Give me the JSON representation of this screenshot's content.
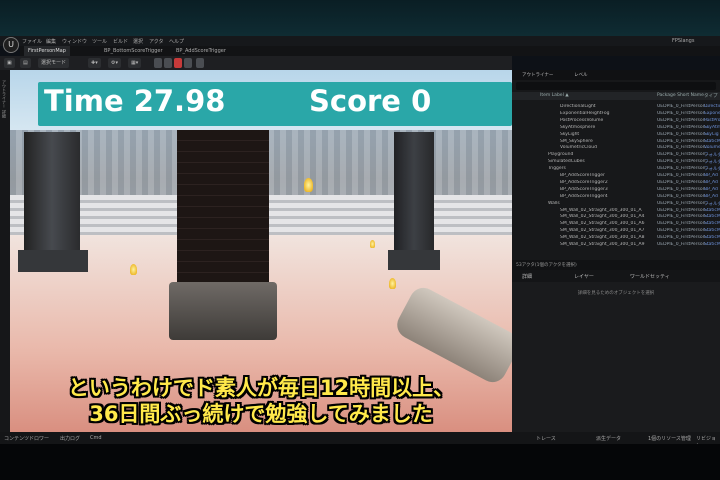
{
  "menu": [
    "ファイル",
    "編集",
    "ウィンドウ",
    "ツール",
    "ビルド",
    "選択",
    "アクタ",
    "ヘルプ"
  ],
  "menu_right": "FPSlangs",
  "tabs": [
    "FirstPersonMap",
    "BP_BottomScoreTrigger",
    "BP_AddScoreTrigger"
  ],
  "toolbar": {
    "mode_label": "選択モード"
  },
  "hud": {
    "time": "Time 27.98",
    "score": "Score 0"
  },
  "subtitle": {
    "line1": "というわけでド素人が毎日12時間以上、",
    "line2": "36日間ぶっ続けで勉強してみました"
  },
  "left_strip": [
    "アウトライナー",
    "詳細"
  ],
  "outliner": {
    "tabs": [
      "アウトライナー",
      "レベル"
    ],
    "columns": [
      "Item Label ▲",
      "Package Short Name",
      "タイプ"
    ],
    "rows": [
      {
        "name": "DirectionalLight",
        "pkg": "UEDPIE_0_FirstPerson...",
        "type": "Directio"
      },
      {
        "name": "ExponentialHeightFog",
        "pkg": "UEDPIE_0_FirstPerson...",
        "type": "Expone"
      },
      {
        "name": "PostProcessVolume",
        "pkg": "UEDPIE_0_FirstPerson...",
        "type": "PostPro"
      },
      {
        "name": "SkyAtmosphere",
        "pkg": "UEDPIE_0_FirstPerson...",
        "type": "SkyAtm"
      },
      {
        "name": "SkyLight",
        "pkg": "UEDPIE_0_FirstPerson...",
        "type": "SkyLig"
      },
      {
        "name": "SM_SkySphere",
        "pkg": "UEDPIE_0_FirstPerson...",
        "type": "StaticM"
      },
      {
        "name": "VolumetricCloud",
        "pkg": "UEDPIE_0_FirstPerson...",
        "type": "Volume"
      },
      {
        "name": "Playground",
        "pkg": "UEDPIE_0_FirstPerson...",
        "type": "フォルダ"
      },
      {
        "name": "SimulatedCubes",
        "pkg": "UEDPIE_0_FirstPerson...",
        "type": "フォルダ"
      },
      {
        "name": "Triggers",
        "pkg": "UEDPIE_0_FirstPerson...",
        "type": "フォルダ"
      },
      {
        "name": "BP_AddScoreTrigger",
        "pkg": "UEDPIE_0_FirstPerson...",
        "type": "BP_Ad"
      },
      {
        "name": "BP_AddScoreTrigger2",
        "pkg": "UEDPIE_0_FirstPerson...",
        "type": "BP_Ad"
      },
      {
        "name": "BP_AddScoreTrigger3",
        "pkg": "UEDPIE_0_FirstPerson...",
        "type": "BP_Ad"
      },
      {
        "name": "BP_AddScoreTrigger4",
        "pkg": "UEDPIE_0_FirstPerson...",
        "type": "BP_Ad"
      },
      {
        "name": "Walls",
        "pkg": "UEDPIE_0_FirstPerson...",
        "type": "フォルダ"
      },
      {
        "name": "SM_Wall_02_Straight_300_300_01_A",
        "pkg": "UEDPIE_0_FirstPerson...",
        "type": "StaticM"
      },
      {
        "name": "SM_Wall_02_Straight_300_300_01_A4",
        "pkg": "UEDPIE_0_FirstPerson...",
        "type": "StaticM"
      },
      {
        "name": "SM_Wall_02_Straight_300_300_01_A6",
        "pkg": "UEDPIE_0_FirstPerson...",
        "type": "StaticM"
      },
      {
        "name": "SM_Wall_02_Straight_300_300_01_A7",
        "pkg": "UEDPIE_0_FirstPerson...",
        "type": "StaticM"
      },
      {
        "name": "SM_Wall_02_Straight_300_300_01_A8",
        "pkg": "UEDPIE_0_FirstPerson...",
        "type": "StaticM"
      },
      {
        "name": "SM_Wall_02_Straight_300_300_01_A9",
        "pkg": "UEDPIE_0_FirstPerson...",
        "type": "StaticM"
      }
    ],
    "footer": "53アクタ(1個のアクタを選択)"
  },
  "details": {
    "tabs": [
      "詳細",
      "レイヤー",
      "ワールドセッティ"
    ],
    "empty_text": "詳細を見るためのオブジェクトを選択"
  },
  "bottom": {
    "left": [
      "コンテンツドロワー",
      "出力ログ",
      "Cmd"
    ],
    "right": [
      "トレース",
      "派生データ",
      "1個のリソース管理",
      "リビジョン"
    ]
  }
}
